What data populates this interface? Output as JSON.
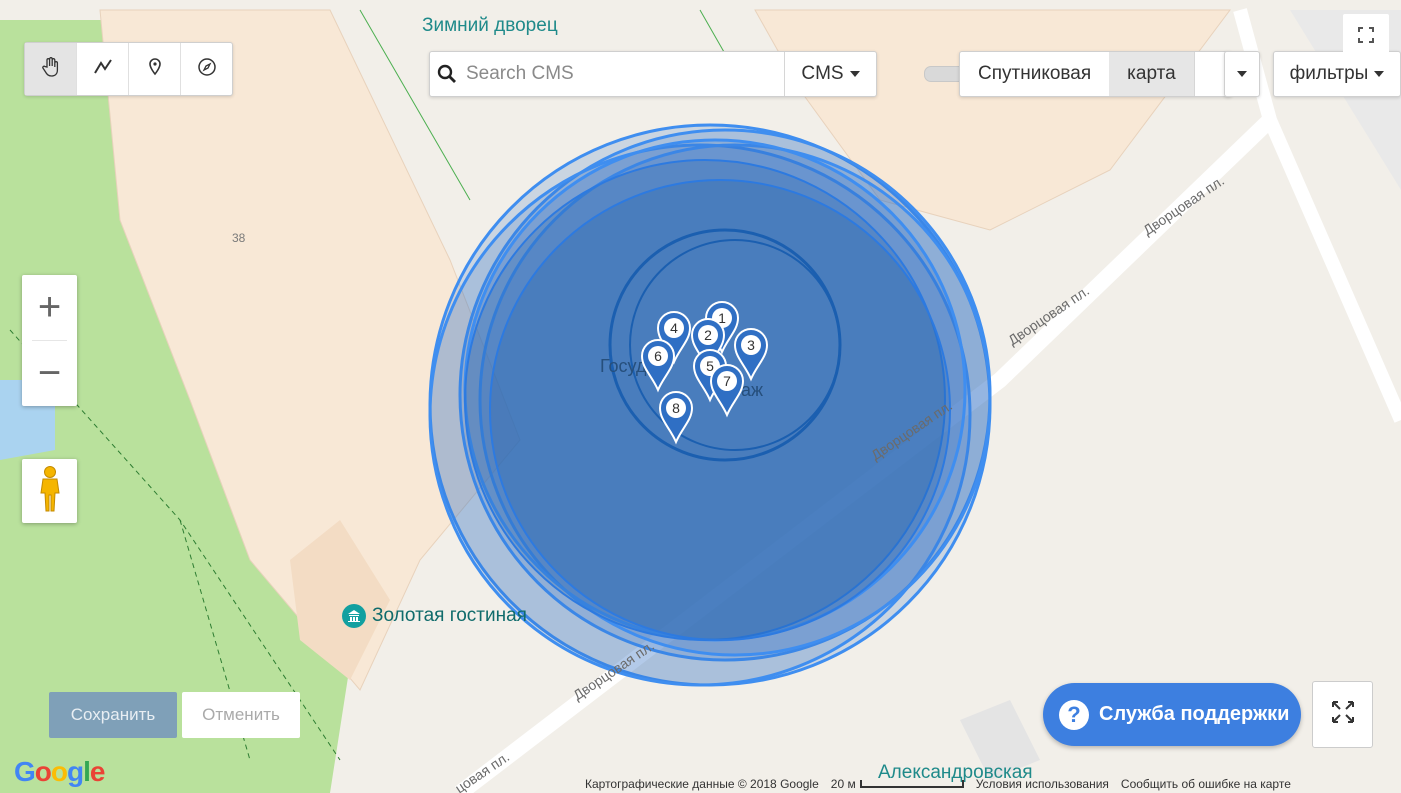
{
  "map": {
    "place_labels": {
      "winter_palace": "Зимний дворец",
      "golden_room": "Золотая гостиная",
      "hermitage_partial_1": "Госуд",
      "hermitage_partial_2": "аж",
      "aleksandrovskaya": "Александровская",
      "building_number": "38"
    },
    "street_label": "Дворцовая пл.",
    "street_label_short": "цовая пл.",
    "markers": [
      "1",
      "2",
      "3",
      "4",
      "5",
      "6",
      "7",
      "8"
    ],
    "colors": {
      "circle": "#2f6fc4",
      "circle_edge": "#3f8ef0",
      "park": "#b9e19c",
      "road": "#ffffff",
      "building": "#f8e8d6"
    }
  },
  "toolbar": {
    "tools": [
      {
        "icon": "hand-pan-icon"
      },
      {
        "icon": "polyline-icon"
      },
      {
        "icon": "map-pin-icon"
      },
      {
        "icon": "compass-icon"
      }
    ]
  },
  "search": {
    "placeholder": "Search CMS",
    "source_label": "CMS"
  },
  "map_type": {
    "satellite_label": "Спутниковая",
    "map_label": "карта",
    "selected": "карта"
  },
  "filters_label": "фильтры",
  "zoom": {
    "in_label": "+",
    "out_label": "−"
  },
  "actions": {
    "save_label": "Сохранить",
    "cancel_label": "Отменить"
  },
  "support": {
    "label": "Служба поддержки",
    "icon": "question-icon"
  },
  "footer": {
    "logo": "Google",
    "data_attribution": "Картографические данные © 2018 Google",
    "scale": "20 м",
    "terms": "Условия использования",
    "report": "Сообщить об ошибке на карте"
  }
}
